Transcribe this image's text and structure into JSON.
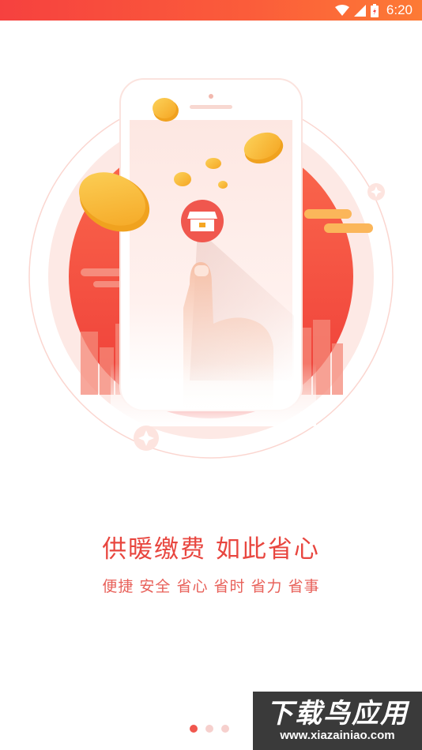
{
  "status_bar": {
    "time": "6:20",
    "icons": [
      "wifi-icon",
      "cellular-signal-icon",
      "battery-icon"
    ]
  },
  "illustration": {
    "icons": [
      "phone-illustration",
      "coin-icon",
      "store-icon",
      "finger-tap-icon",
      "sparkle-icon",
      "cloud-icon",
      "city-buildings"
    ]
  },
  "onboarding": {
    "title": "供暖缴费 如此省心",
    "subtitle": "便捷 安全 省心 省时 省力 省事",
    "page_indicator": {
      "total": 3,
      "current": 1
    }
  },
  "watermark": {
    "title": "下载鸟应用",
    "url": "www.xiazainiao.com"
  },
  "colors": {
    "accent": "#f0574e",
    "status_bar": "#f6413f",
    "coin": "#f9b531"
  }
}
